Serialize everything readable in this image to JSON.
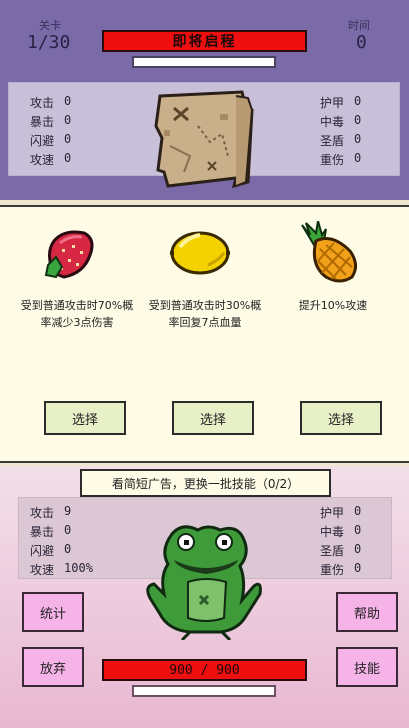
{
  "header": {
    "level_label": "关卡",
    "level_value": "1/30",
    "time_label": "时间",
    "time_value": "0",
    "title": "即将启程"
  },
  "enemy_stats": {
    "left": [
      {
        "label": "攻击",
        "value": "0"
      },
      {
        "label": "暴击",
        "value": "0"
      },
      {
        "label": "闪避",
        "value": "0"
      },
      {
        "label": "攻速",
        "value": "0"
      }
    ],
    "right": [
      {
        "label": "护甲",
        "value": "0"
      },
      {
        "label": "中毒",
        "value": "0"
      },
      {
        "label": "圣盾",
        "value": "0"
      },
      {
        "label": "重伤",
        "value": "0"
      }
    ],
    "icon": "treasure-map-icon"
  },
  "choices": [
    {
      "icon": "strawberry-icon",
      "description": "受到普通攻击时70%概率减少3点伤害",
      "button": "选择"
    },
    {
      "icon": "lemon-icon",
      "description": "受到普通攻击时30%概率回复7点血量",
      "button": "选择"
    },
    {
      "icon": "pineapple-icon",
      "description": "提升10%攻速",
      "button": "选择"
    }
  ],
  "ad_refresh": {
    "label": "看简短广告，更换一批技能（0/2）"
  },
  "player_stats": {
    "left": [
      {
        "label": "攻击",
        "value": "9"
      },
      {
        "label": "暴击",
        "value": "0"
      },
      {
        "label": "闪避",
        "value": "0"
      },
      {
        "label": "攻速",
        "value": "100%"
      }
    ],
    "right": [
      {
        "label": "护甲",
        "value": "0"
      },
      {
        "label": "中毒",
        "value": "0"
      },
      {
        "label": "圣盾",
        "value": "0"
      },
      {
        "label": "重伤",
        "value": "0"
      }
    ],
    "icon": "frog-icon"
  },
  "buttons": {
    "stats": "统计",
    "give_up": "放弃",
    "help": "帮助",
    "skills": "技能"
  },
  "hp": {
    "text": "900 / 900"
  },
  "colors": {
    "top_band": "#7a6aa8",
    "title_bar": "#ee1010",
    "choice_panel": "#fefce6",
    "pink_button": "#f6b3e8"
  }
}
